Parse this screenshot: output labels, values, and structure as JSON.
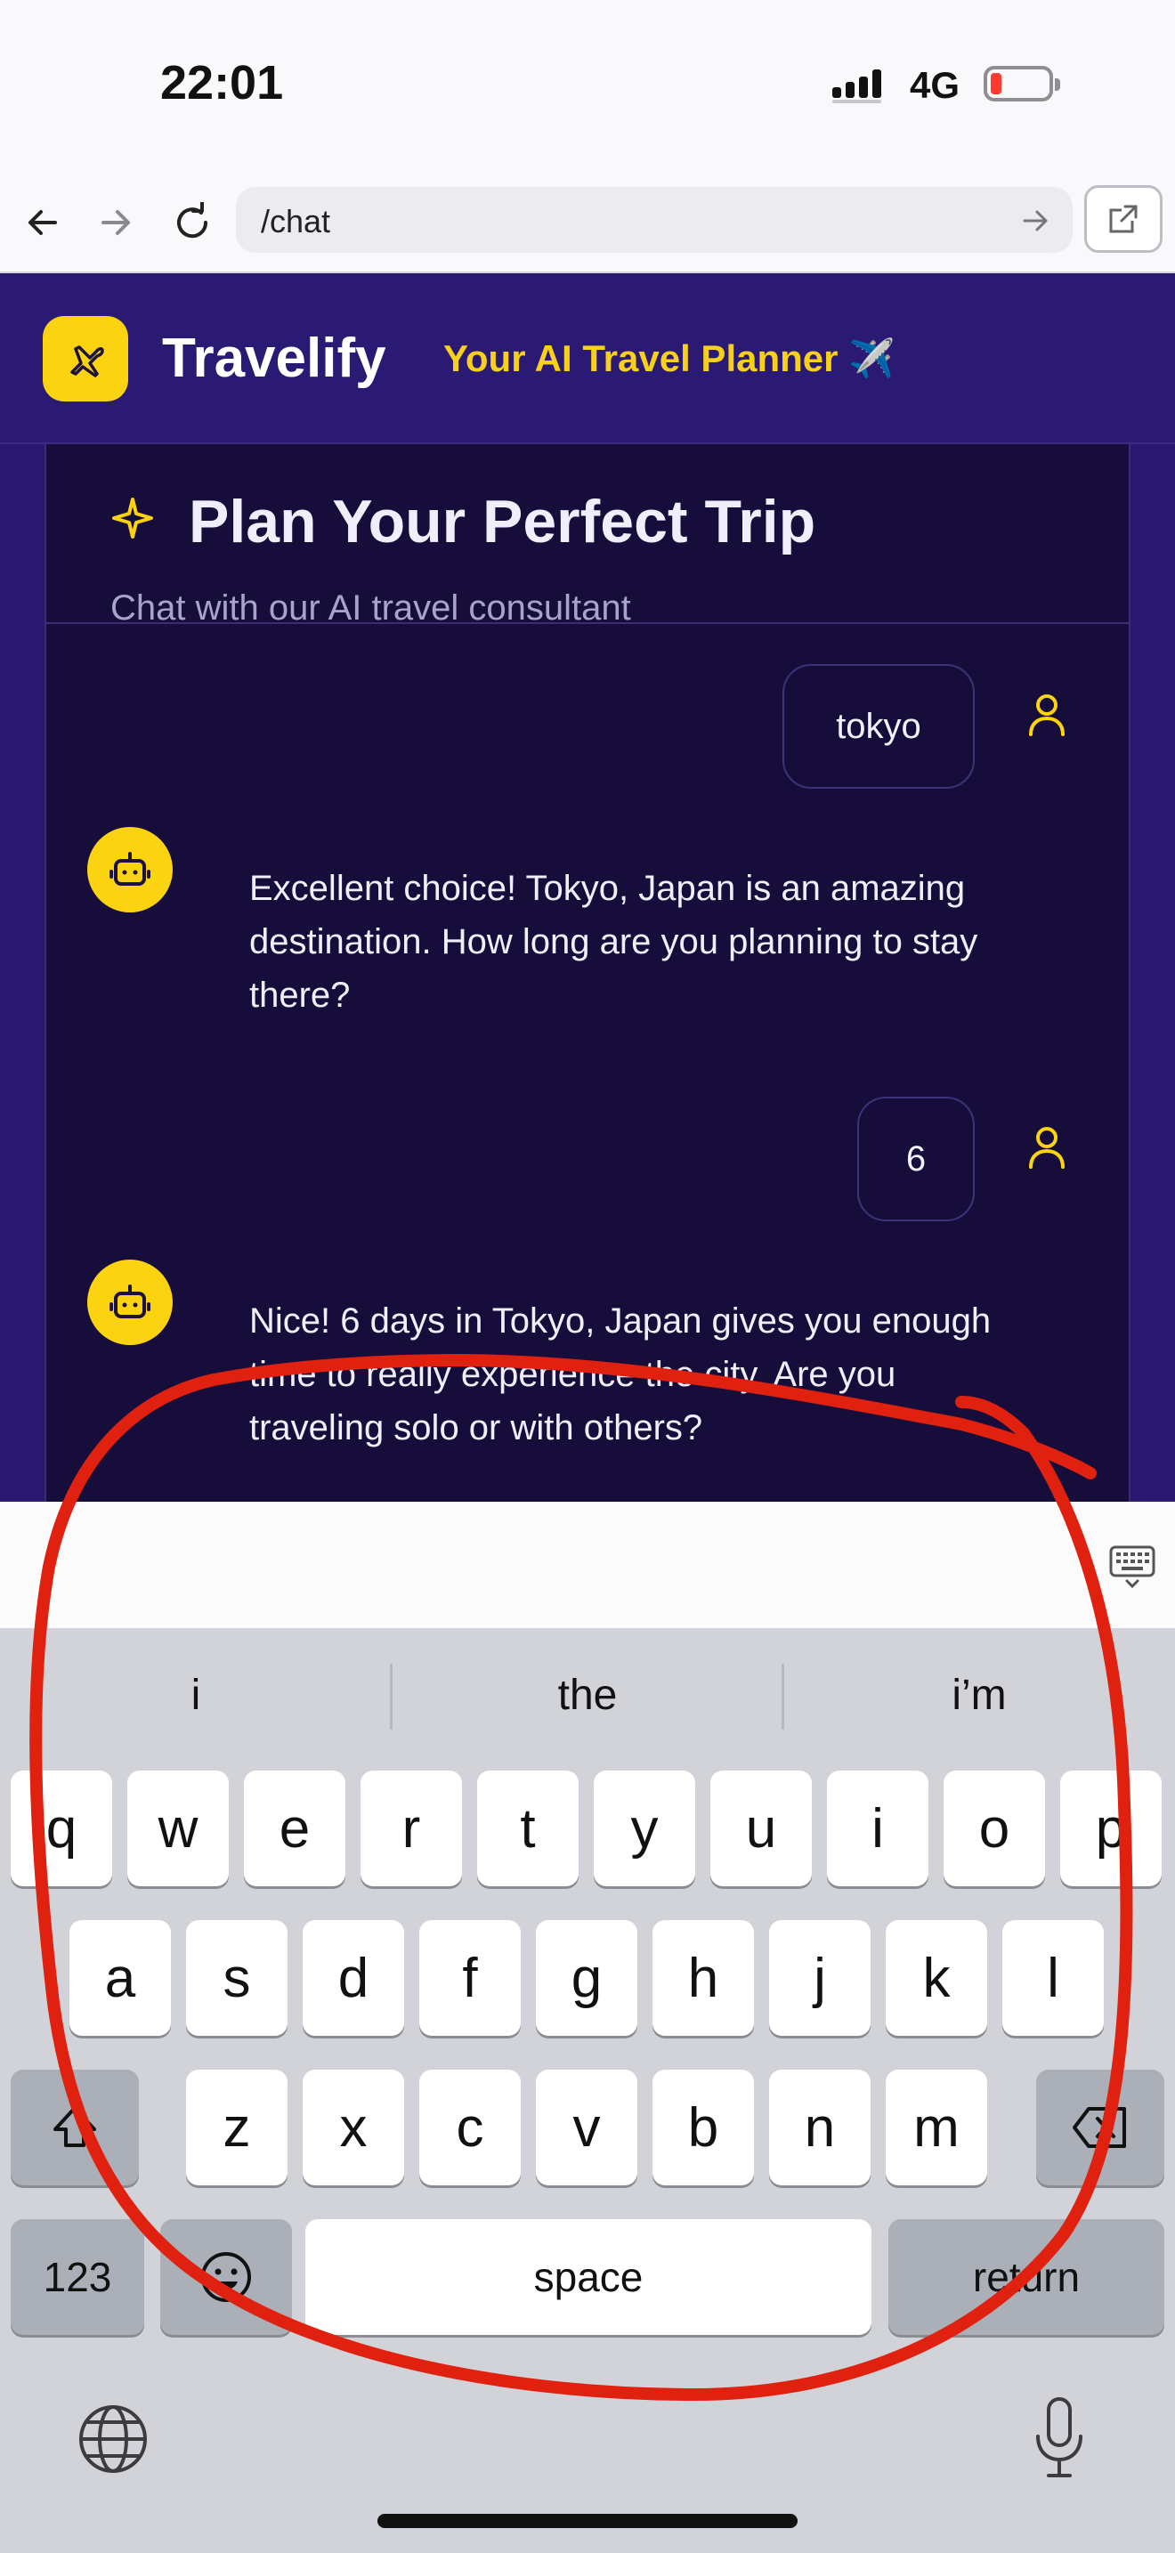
{
  "status_bar": {
    "time": "22:01",
    "network": "4G"
  },
  "browser": {
    "url": "/chat"
  },
  "app": {
    "brand": "Travelify",
    "tagline": "Your AI Travel Planner ✈️",
    "panel_title": "Plan Your Perfect Trip",
    "panel_subtitle": "Chat with our AI travel consultant"
  },
  "messages": [
    {
      "role": "user",
      "text": "tokyo"
    },
    {
      "role": "bot",
      "text": "Excellent choice! Tokyo, Japan is an amazing destination. How long are you planning to stay there?"
    },
    {
      "role": "user",
      "text": "6"
    },
    {
      "role": "bot",
      "text": "Nice! 6 days in Tokyo, Japan gives you enough time to really experience the city. Are you traveling solo or with others?"
    }
  ],
  "keyboard": {
    "suggestions": [
      "i",
      "the",
      "i’m"
    ],
    "row1": [
      "q",
      "w",
      "e",
      "r",
      "t",
      "y",
      "u",
      "i",
      "o",
      "p"
    ],
    "row2": [
      "a",
      "s",
      "d",
      "f",
      "g",
      "h",
      "j",
      "k",
      "l"
    ],
    "row3": [
      "z",
      "x",
      "c",
      "v",
      "b",
      "n",
      "m"
    ],
    "numbers_label": "123",
    "space_label": "space",
    "return_label": "return"
  },
  "colors": {
    "brand_yellow": "#fcd310",
    "header_purple": "#2b1a74",
    "panel_bg": "#170d3a",
    "annotation_red": "#e0210f"
  }
}
